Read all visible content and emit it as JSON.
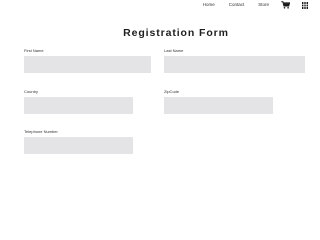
{
  "nav": {
    "links": [
      "Home",
      "Contact",
      "Store"
    ],
    "cart_icon": "cart-icon",
    "menu_icon": "grid-menu-icon"
  },
  "title": "Registration Form",
  "fields": {
    "first_name": {
      "label": "First Name",
      "value": ""
    },
    "last_name": {
      "label": "Last Name",
      "value": ""
    },
    "country": {
      "label": "Country",
      "value": ""
    },
    "zipcode": {
      "label": "ZipCode",
      "value": ""
    },
    "telephone": {
      "label": "Telephone Number",
      "value": ""
    }
  },
  "colors": {
    "input_bg": "#e4e3e6",
    "text": "#222222"
  }
}
